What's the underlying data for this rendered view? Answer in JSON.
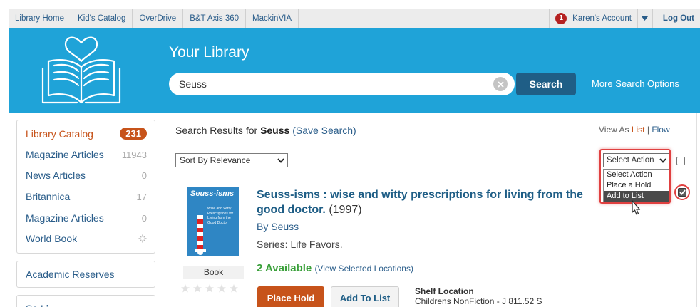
{
  "topnav": {
    "links": [
      "Library Home",
      "Kid's Catalog",
      "OverDrive",
      "B&T Axis 360",
      "MackinVIA"
    ],
    "notification_count": "1",
    "account_label": "Karen's Account",
    "logout_label": "Log Out"
  },
  "header": {
    "site_title": "Your Library",
    "search_value": "Seuss",
    "search_button": "Search",
    "more_options": "More Search Options"
  },
  "sidebar": {
    "items": [
      {
        "label": "Library Catalog",
        "count": "231"
      },
      {
        "label": "Magazine Articles",
        "count": "11943"
      },
      {
        "label": "News Articles",
        "count": "0"
      },
      {
        "label": "Britannica",
        "count": "17"
      },
      {
        "label": "Magazine Articles",
        "count": "0"
      },
      {
        "label": "World Book",
        "count": ""
      }
    ],
    "academic_reserves": "Academic Reserves",
    "third_box_partial": "Sa  Li"
  },
  "results": {
    "prefix": "Search Results for",
    "query": "Seuss",
    "save_search": "(Save Search)",
    "view_as_label": "View As",
    "view_list": "List",
    "view_sep": "|",
    "view_flow": "Flow",
    "sort_value": "Sort By Relevance",
    "action_select_value": "Select Action",
    "action_options": [
      "Select Action",
      "Place a Hold",
      "Add to List"
    ]
  },
  "item": {
    "cover_title": "Seuss-isms",
    "cover_subtitle": "Wise and Witty Prescriptions for Living from the Good Doctor",
    "format": "Book",
    "title": "Seuss-isms : wise and witty prescriptions for living from the good doctor.",
    "year": "(1997)",
    "author": "By Seuss",
    "series": "Series: Life Favors.",
    "availability": "2 Available",
    "view_locations": "(View Selected Locations)",
    "place_hold": "Place Hold",
    "add_to_list": "Add To List",
    "shelf_label": "Shelf Location",
    "shelf_value": "Childrens NonFiction - J 811.52 S"
  },
  "colors": {
    "header_blue": "#1fa3d8",
    "accent_orange": "#c7531a",
    "link_blue": "#2a5d8a",
    "available_green": "#3aa03a",
    "highlight_red": "#e04040"
  }
}
